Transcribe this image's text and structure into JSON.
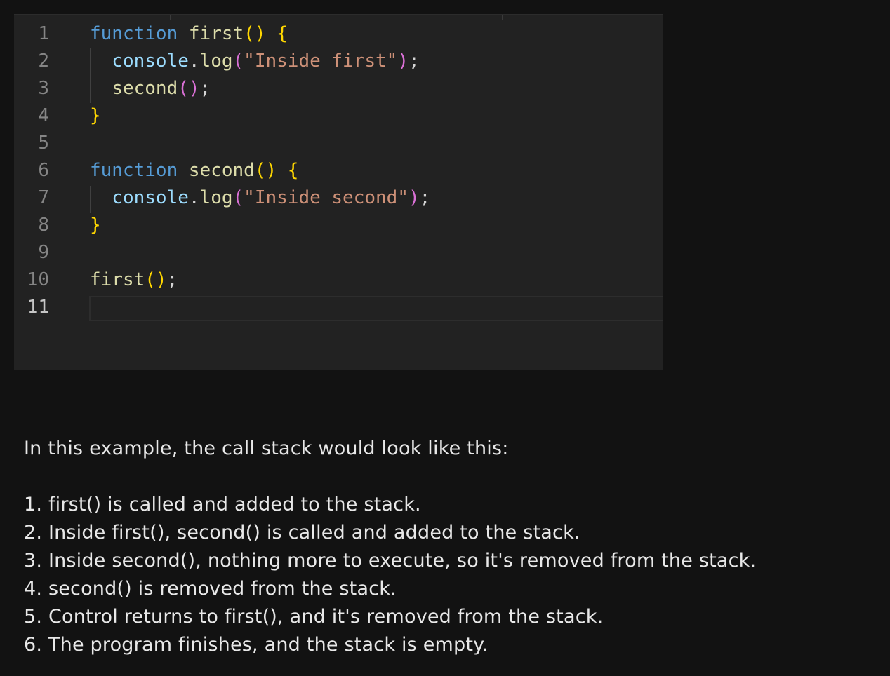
{
  "editor": {
    "lines": [
      {
        "num": "1",
        "tokens": [
          {
            "t": "function",
            "c": "kw"
          },
          {
            "t": " ",
            "c": "pl"
          },
          {
            "t": "first",
            "c": "fn"
          },
          {
            "t": "()",
            "c": "br1"
          },
          {
            "t": " ",
            "c": "pl"
          },
          {
            "t": "{",
            "c": "br1"
          }
        ]
      },
      {
        "num": "2",
        "tokens": [
          {
            "t": "  ",
            "c": "pl"
          },
          {
            "t": "console",
            "c": "var"
          },
          {
            "t": ".",
            "c": "pl"
          },
          {
            "t": "log",
            "c": "fn"
          },
          {
            "t": "(",
            "c": "br2"
          },
          {
            "t": "\"Inside first\"",
            "c": "str"
          },
          {
            "t": ")",
            "c": "br2"
          },
          {
            "t": ";",
            "c": "pl"
          }
        ]
      },
      {
        "num": "3",
        "tokens": [
          {
            "t": "  ",
            "c": "pl"
          },
          {
            "t": "second",
            "c": "fn"
          },
          {
            "t": "()",
            "c": "br2"
          },
          {
            "t": ";",
            "c": "pl"
          }
        ]
      },
      {
        "num": "4",
        "tokens": [
          {
            "t": "}",
            "c": "br1"
          }
        ]
      },
      {
        "num": "5",
        "tokens": []
      },
      {
        "num": "6",
        "tokens": [
          {
            "t": "function",
            "c": "kw"
          },
          {
            "t": " ",
            "c": "pl"
          },
          {
            "t": "second",
            "c": "fn"
          },
          {
            "t": "()",
            "c": "br1"
          },
          {
            "t": " ",
            "c": "pl"
          },
          {
            "t": "{",
            "c": "br1"
          }
        ]
      },
      {
        "num": "7",
        "tokens": [
          {
            "t": "  ",
            "c": "pl"
          },
          {
            "t": "console",
            "c": "var"
          },
          {
            "t": ".",
            "c": "pl"
          },
          {
            "t": "log",
            "c": "fn"
          },
          {
            "t": "(",
            "c": "br2"
          },
          {
            "t": "\"Inside second\"",
            "c": "str"
          },
          {
            "t": ")",
            "c": "br2"
          },
          {
            "t": ";",
            "c": "pl"
          }
        ]
      },
      {
        "num": "8",
        "tokens": [
          {
            "t": "}",
            "c": "br1"
          }
        ]
      },
      {
        "num": "9",
        "tokens": []
      },
      {
        "num": "10",
        "tokens": [
          {
            "t": "first",
            "c": "fn"
          },
          {
            "t": "()",
            "c": "br1"
          },
          {
            "t": ";",
            "c": "pl"
          }
        ]
      },
      {
        "num": "11",
        "tokens": [],
        "active": true
      }
    ]
  },
  "explanation": {
    "intro": "In this example, the call stack would look like this:",
    "steps": [
      "1. first() is called and added to the stack.",
      "2. Inside first(), second() is called and added to the stack.",
      "3. Inside second(), nothing more to execute, so it's removed from the stack.",
      "4. second() is removed from the stack.",
      "5. Control returns to first(), and it's removed from the stack.",
      "6. The program finishes, and the stack is empty."
    ]
  }
}
